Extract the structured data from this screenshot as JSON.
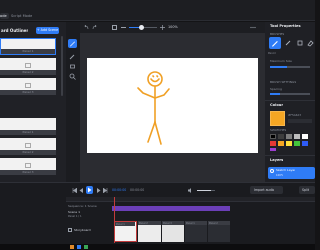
{
  "topbar": {
    "tab_active": "ode",
    "tab_script": "Script Mode"
  },
  "left": {
    "title": "ard Outliner",
    "add_scene_label": "+ Add Scene",
    "scene1_panels": [
      "Panel 1",
      "Panel 2",
      "Panel 3"
    ],
    "scene2_panels": [
      "Panel 1",
      "Panel 2",
      "Panel 3"
    ]
  },
  "canvas": {
    "zoom_label": "100%"
  },
  "right": {
    "tool_props_title": "Tool Properties",
    "brushes_label": "BRUSHES",
    "brush_names": [
      "Pencil",
      "Brush",
      "Ink",
      "Eraser"
    ],
    "max_size_label": "Maximum Size",
    "brush_settings_label": "BRUSH SETTINGS",
    "spacing_label": "Spacing",
    "colour_title": "Colour",
    "colour_hex_label": "#F5A623",
    "swatches_label": "SWATCHES",
    "layers_title": "Layers",
    "layer_name": "Sketch Layer",
    "layer_opacity": "100%"
  },
  "timeline": {
    "timecode_current": "00:00:00",
    "timecode_total": "00:00:00",
    "import_audio_label": "Import audio",
    "split_label": "Split",
    "track_label": "Sequence: 1 Scene",
    "scene_label": "Scene 1",
    "scene_sub": "Panel 1 / 1",
    "storyboard_label": "Storyboard",
    "panel_labels": [
      "Panel 1",
      "Panel 2",
      "Panel 3",
      "Panel 1",
      "Panel 2"
    ]
  },
  "colors": {
    "accent": "#2f7cf6",
    "orange": "#f5a623",
    "selected_track": "#c13b3b",
    "purple": "#6b3fb8"
  }
}
